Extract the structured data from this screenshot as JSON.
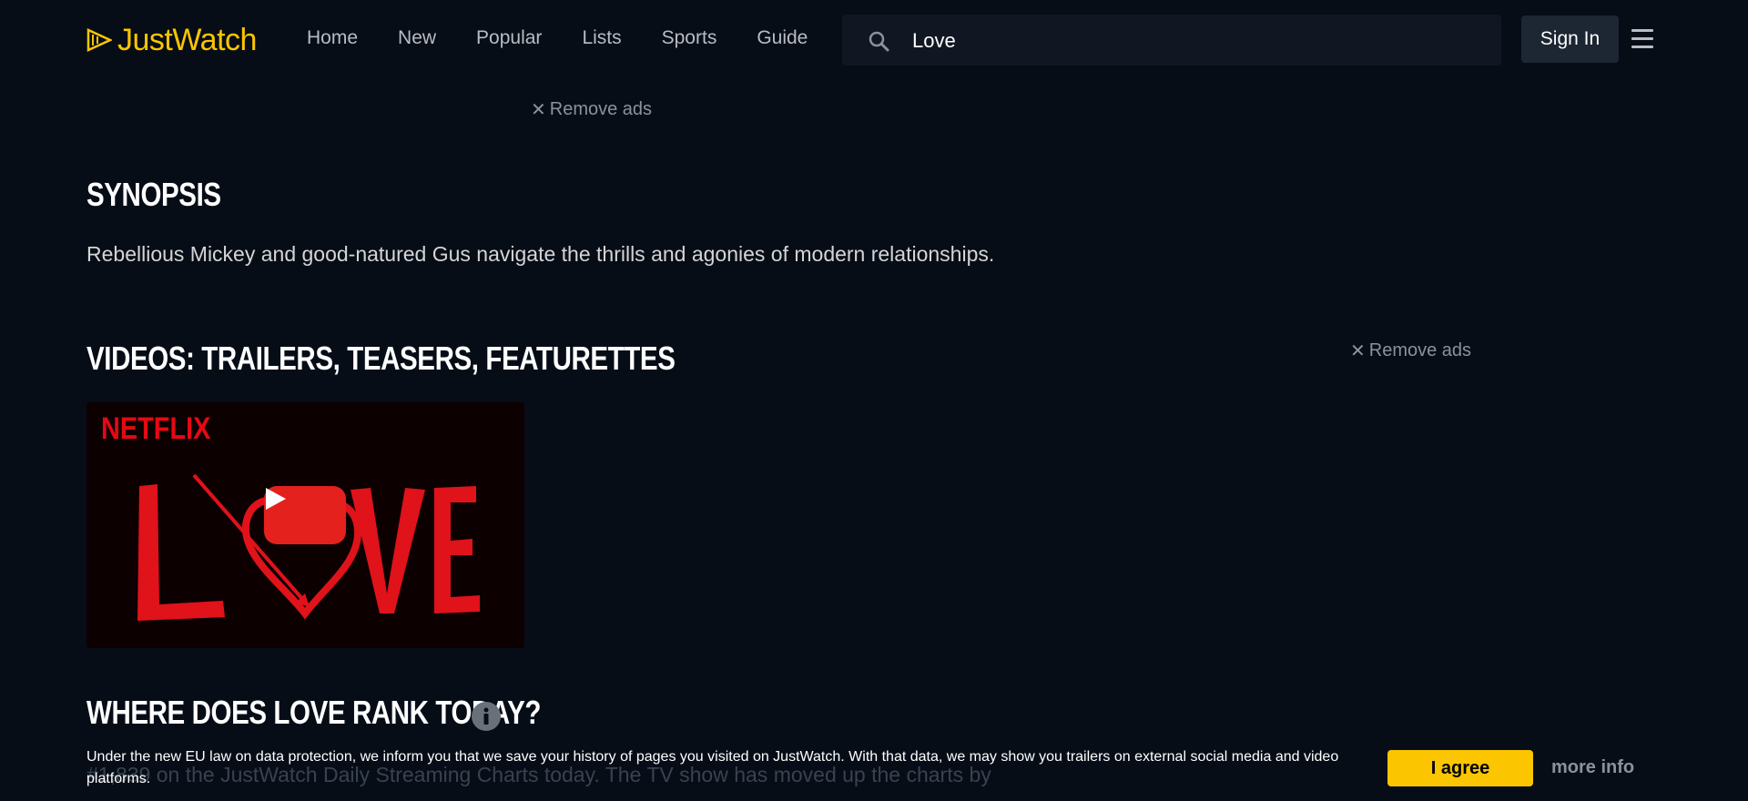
{
  "header": {
    "logo_text": "JustWatch",
    "nav": [
      "Home",
      "New",
      "Popular",
      "Lists",
      "Sports",
      "Guide"
    ],
    "search": {
      "value": "Love"
    },
    "signin_label": "Sign In"
  },
  "ads": {
    "remove_label": "Remove ads"
  },
  "synopsis": {
    "title": "SYNOPSIS",
    "text": "Rebellious Mickey and good-natured Gus navigate the thrills and agonies of modern relationships."
  },
  "videos": {
    "title": "VIDEOS: TRAILERS, TEASERS, FEATURETTES",
    "thumb_brand": "NETFLIX",
    "thumb_title": "LOVE"
  },
  "rank": {
    "title": "WHERE DOES LOVE RANK TODAY?",
    "text_line1": "#1,839 on the JustWatch Daily Streaming Charts today. The TV show has moved up the charts by"
  },
  "consent": {
    "text": "Under the new EU law on data protection, we inform you that we save your history of pages you visited on JustWatch. With that data, we may show you trailers on external social media and video platforms.",
    "agree_label": "I agree",
    "more_label": "more info"
  },
  "colors": {
    "brand": "#fbc500",
    "background": "#060d17",
    "netflix_red": "#e50914"
  }
}
